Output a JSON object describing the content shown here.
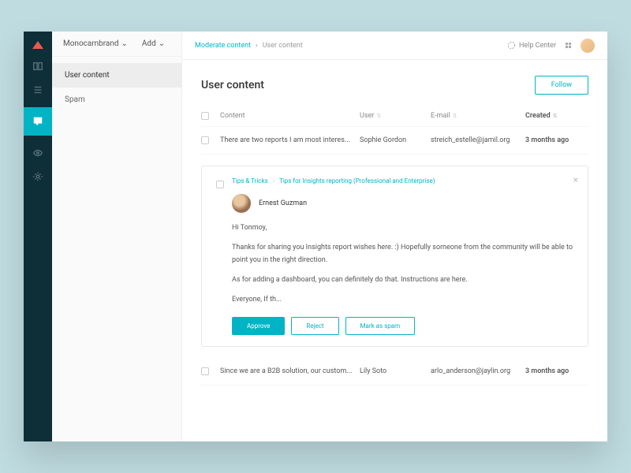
{
  "sidebar": {
    "brand": "Monocambrand",
    "add": "Add",
    "items": [
      {
        "label": "User content",
        "active": true
      },
      {
        "label": "Spam",
        "active": false
      }
    ]
  },
  "topbar": {
    "breadcrumb": {
      "parent": "Moderate content",
      "current": "User content"
    },
    "help": "Help Center"
  },
  "header": {
    "title": "User content",
    "follow": "Follow"
  },
  "table": {
    "cols": {
      "content": "Content",
      "user": "User",
      "email": "E-mail",
      "created": "Created"
    },
    "rows": [
      {
        "content": "There are two reports I am most interes...",
        "user": "Sophie Gordon",
        "email": "streich_estelle@jamil.org",
        "created": "3 months ago"
      },
      {
        "content": "Since we are a B2B solution, our custom...",
        "user": "Lily Soto",
        "email": "arlo_anderson@jaylin.org",
        "created": "3 months ago"
      }
    ]
  },
  "card": {
    "crumb": {
      "a": "Tips & Tricks",
      "b": "Tips for Insights reporting (Professional and Enterprise)"
    },
    "author": "Ernest Guzman",
    "body": [
      "Hi Tonmoy,",
      "Thanks for sharing you Insights report wishes here. :) Hopefully someone from the community will be able to point you in the right direction.",
      "As for adding a dashboard, you can definitely do that. Instructions are here.",
      "Everyone, If th..."
    ],
    "actions": {
      "approve": "Approve",
      "reject": "Reject",
      "spam": "Mark as spam"
    }
  }
}
